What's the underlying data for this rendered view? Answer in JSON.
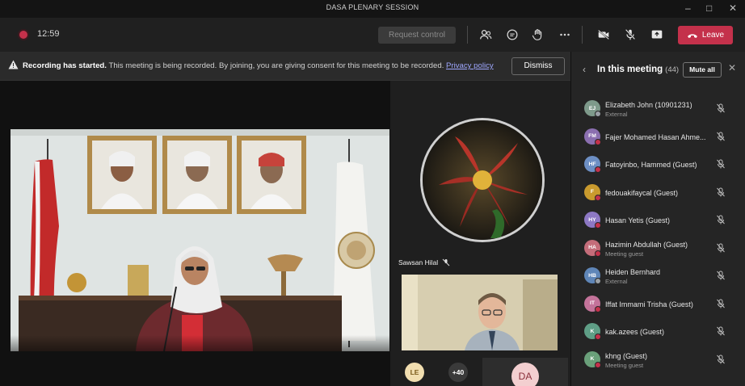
{
  "window": {
    "title": "DASA PLENARY SESSION"
  },
  "toolbar": {
    "timer": "12:59",
    "request_control": "Request control",
    "leave": "Leave",
    "icons": [
      "people-icon",
      "chat-icon",
      "raise-hand-icon",
      "more-icon",
      "camera-off-icon",
      "mic-off-icon",
      "share-icon",
      "phone-icon"
    ]
  },
  "banner": {
    "bold": "Recording has started.",
    "text": " This meeting is being recorded. By joining, you are giving consent for this meeting to be recorded. ",
    "policy": "Privacy policy",
    "dismiss": "Dismiss"
  },
  "stage": {
    "speaker_name": "Sawsan Hilal",
    "bottom_initials_1": "LE",
    "overflow_count": "+40",
    "bottom_initials_2": "DA"
  },
  "panel": {
    "title": "In this meeting",
    "count": "(44)",
    "mute_all": "Mute all",
    "participants": [
      {
        "initials": "EJ",
        "name": "Elizabeth John (10901231)",
        "sub": "External",
        "color": "#7e9a8b",
        "status": "ext"
      },
      {
        "initials": "FM",
        "name": "Fajer Mohamed Hasan Ahme...",
        "sub": "",
        "color": "#8b6fb0",
        "status": "red"
      },
      {
        "initials": "HF",
        "name": "Fatoyinbo, Hammed (Guest)",
        "sub": "",
        "color": "#6d8fc4",
        "status": "red"
      },
      {
        "initials": "F",
        "name": "fedouakifaycal (Guest)",
        "sub": "",
        "color": "#c99a2e",
        "status": "red"
      },
      {
        "initials": "HY",
        "name": "Hasan Yetis (Guest)",
        "sub": "",
        "color": "#8d78c4",
        "status": "red"
      },
      {
        "initials": "HA",
        "name": "Hazimin Abdullah (Guest)",
        "sub": "Meeting guest",
        "color": "#c46d7a",
        "status": "red"
      },
      {
        "initials": "HB",
        "name": "Heiden Bernhard",
        "sub": "External",
        "color": "#5f86b8",
        "status": "ext"
      },
      {
        "initials": "IT",
        "name": "Iffat Immami Trisha (Guest)",
        "sub": "",
        "color": "#c4739a",
        "status": "red"
      },
      {
        "initials": "K",
        "name": "kak.azees (Guest)",
        "sub": "",
        "color": "#5f9e86",
        "status": "red"
      },
      {
        "initials": "K",
        "name": "khng (Guest)",
        "sub": "Meeting guest",
        "color": "#6aa07a",
        "status": "red"
      }
    ]
  }
}
